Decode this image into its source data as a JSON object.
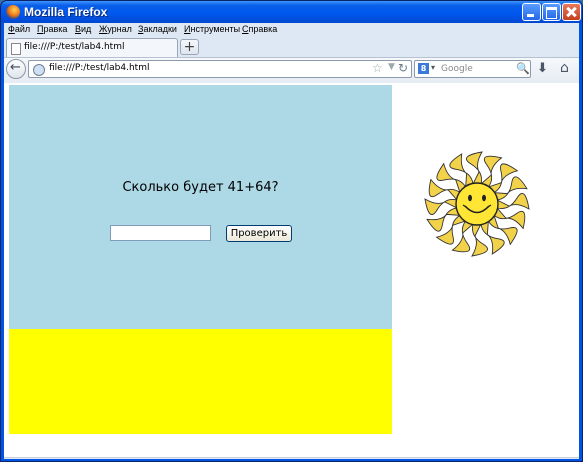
{
  "window": {
    "title": "Mozilla Firefox"
  },
  "menubar": {
    "items": [
      "Файл",
      "Правка",
      "Вид",
      "Журнал",
      "Закладки",
      "Инструменты",
      "Справка"
    ]
  },
  "tabs": [
    {
      "title": "file:///P:/test/lab4.html"
    }
  ],
  "navbar": {
    "url": "file:///P:/test/lab4.html",
    "search_placeholder": "Google",
    "search_engine_letter": "8"
  },
  "page": {
    "question": "Сколько будет 41+64?",
    "answer_value": "",
    "check_button": "Проверить",
    "sun_icon": "smiling-sun-icon"
  },
  "colors": {
    "blue_panel": "#add8e6",
    "yellow_panel": "#ffff00",
    "titlebar": "#0058ee"
  }
}
